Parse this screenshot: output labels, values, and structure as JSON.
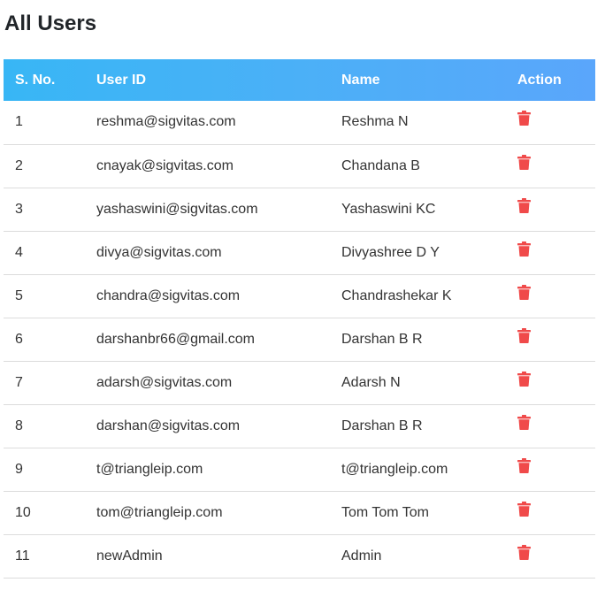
{
  "page": {
    "title": "All Users"
  },
  "table": {
    "headers": {
      "sno": "S. No.",
      "user_id": "User ID",
      "name": "Name",
      "action": "Action"
    },
    "rows": [
      {
        "sno": "1",
        "user_id": "reshma@sigvitas.com",
        "name": "Reshma N"
      },
      {
        "sno": "2",
        "user_id": "cnayak@sigvitas.com",
        "name": "Chandana B"
      },
      {
        "sno": "3",
        "user_id": "yashaswini@sigvitas.com",
        "name": "Yashaswini KC"
      },
      {
        "sno": "4",
        "user_id": "divya@sigvitas.com",
        "name": "Divyashree D Y"
      },
      {
        "sno": "5",
        "user_id": "chandra@sigvitas.com",
        "name": "Chandrashekar K"
      },
      {
        "sno": "6",
        "user_id": "darshanbr66@gmail.com",
        "name": "Darshan B R"
      },
      {
        "sno": "7",
        "user_id": "adarsh@sigvitas.com",
        "name": "Adarsh N"
      },
      {
        "sno": "8",
        "user_id": "darshan@sigvitas.com",
        "name": "Darshan B R"
      },
      {
        "sno": "9",
        "user_id": "t@triangleip.com",
        "name": "t@triangleip.com"
      },
      {
        "sno": "10",
        "user_id": "tom@triangleip.com",
        "name": "Tom Tom Tom"
      },
      {
        "sno": "11",
        "user_id": "newAdmin",
        "name": "Admin"
      }
    ],
    "action_icon": "trash-icon"
  },
  "colors": {
    "header_gradient_start": "#38b6f5",
    "header_gradient_end": "#5aa6fb",
    "delete_icon": "#f04a4a",
    "row_divider": "#dcdcdc"
  }
}
